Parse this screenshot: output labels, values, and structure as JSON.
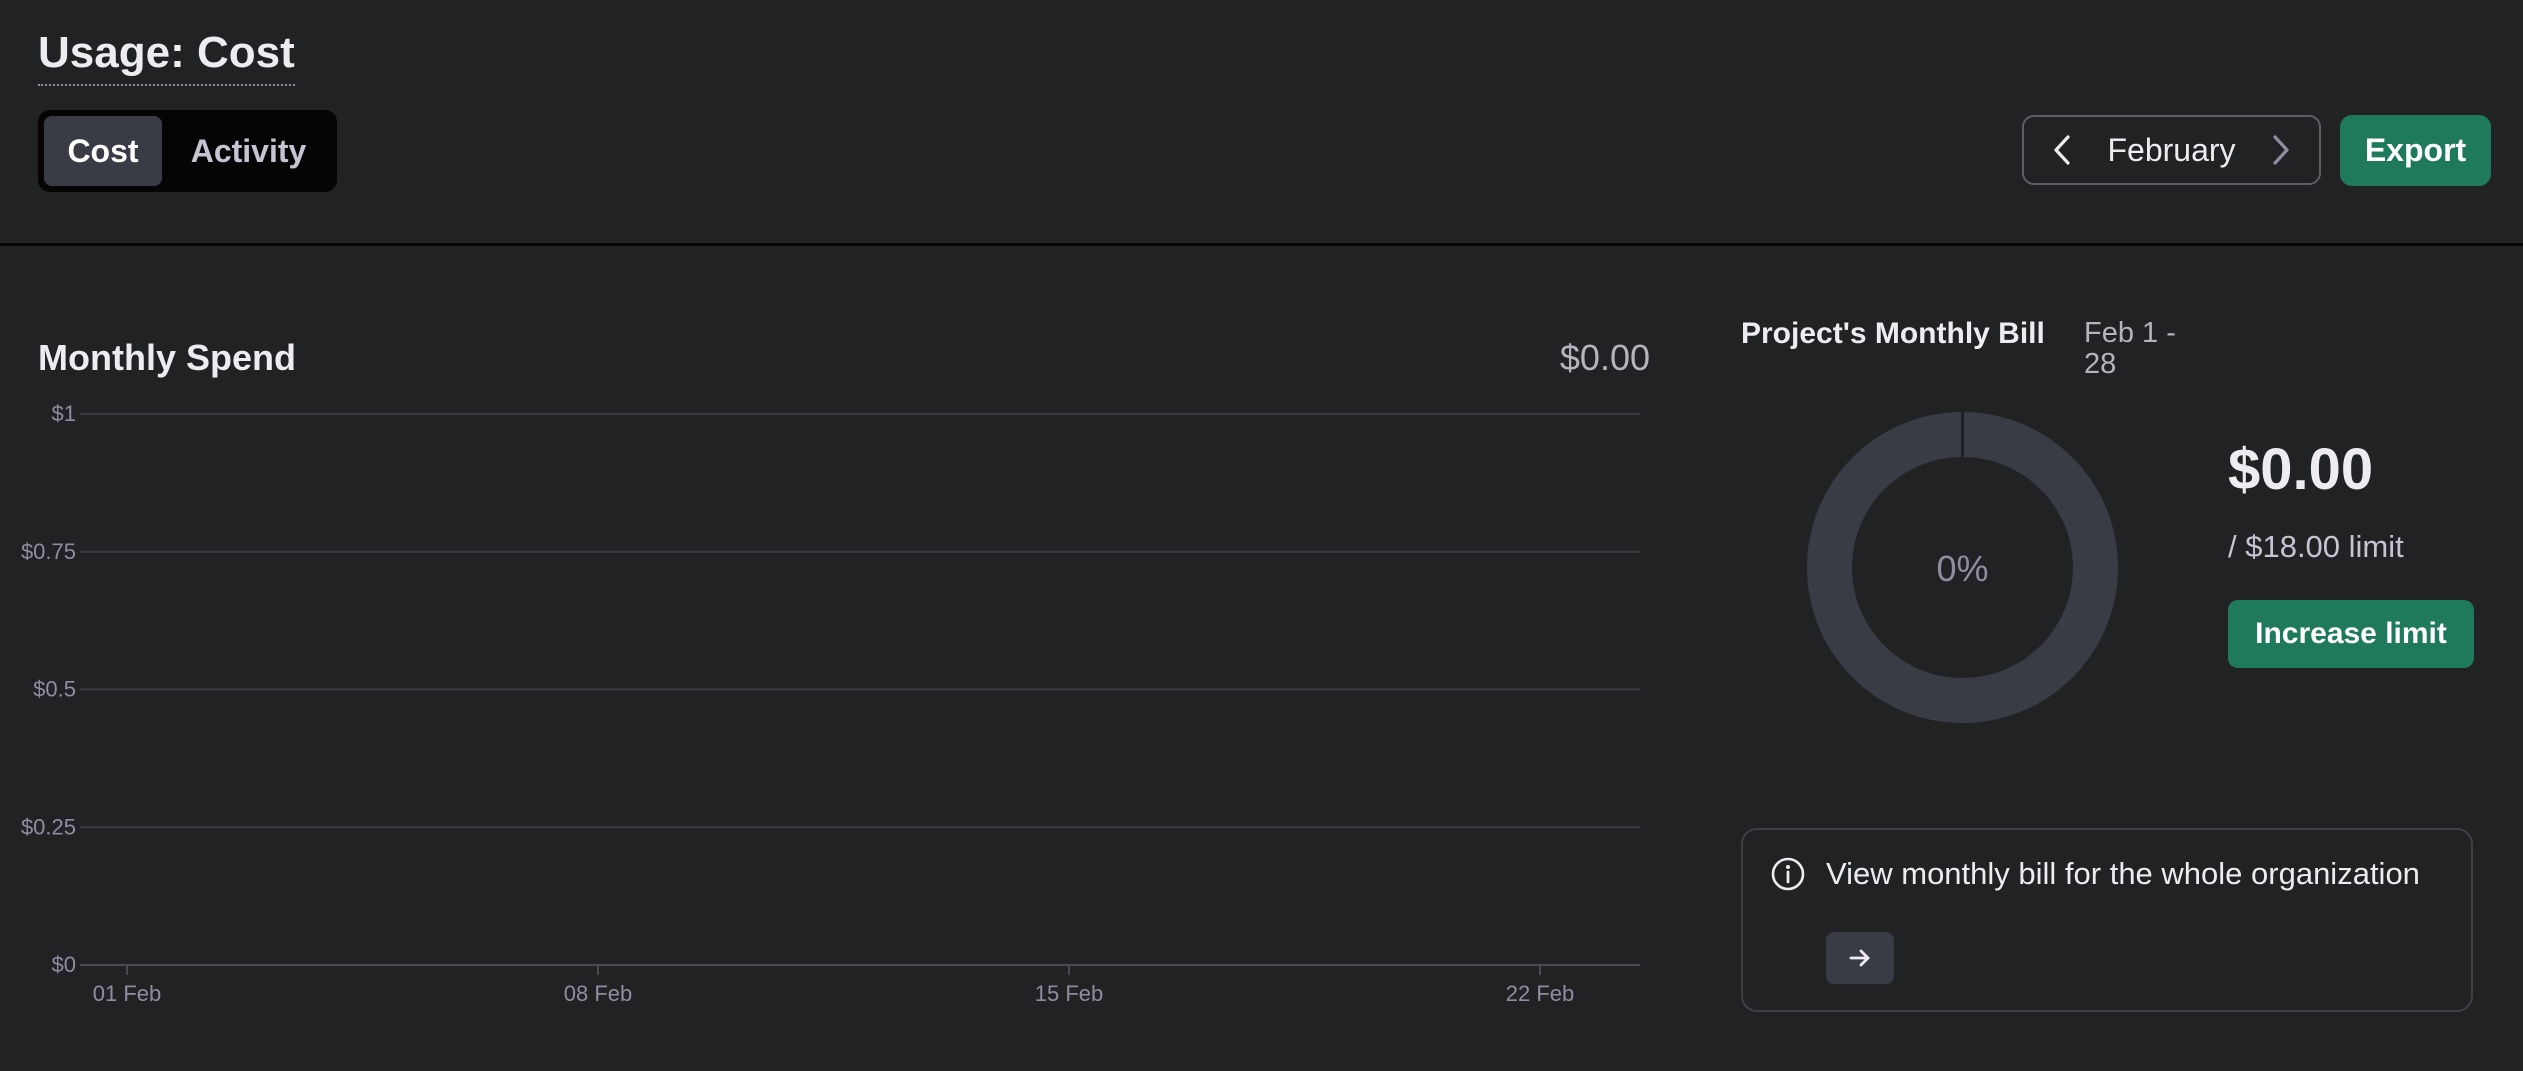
{
  "header": {
    "title": "Usage: Cost",
    "tabs": [
      {
        "label": "Cost",
        "active": true
      },
      {
        "label": "Activity",
        "active": false
      }
    ],
    "month_picker": {
      "month": "February",
      "prev_icon": "chevron-left-icon",
      "next_icon": "chevron-right-icon"
    },
    "export_label": "Export"
  },
  "monthly_spend": {
    "title": "Monthly Spend",
    "total": "$0.00"
  },
  "chart_data": {
    "type": "bar",
    "x_tick_labels": [
      "01 Feb",
      "08 Feb",
      "15 Feb",
      "22 Feb"
    ],
    "y_tick_labels": [
      "$0",
      "$0.25",
      "$0.5",
      "$0.75",
      "$1"
    ],
    "y_ticks": [
      0,
      0.25,
      0.5,
      0.75,
      1
    ],
    "ylim": [
      0,
      1
    ],
    "grid": true,
    "values": []
  },
  "bill": {
    "title": "Project's Monthly Bill",
    "range": "Feb 1 - 28",
    "percent_label": "0%",
    "percent_value": 0,
    "amount": "$0.00",
    "limit": "/ $18.00 limit",
    "increase_label": "Increase limit",
    "ring_color": "#3a3c45"
  },
  "org_card": {
    "icon": "info-icon",
    "text": "View monthly bill for the whole organization",
    "arrow_icon": "arrow-right-icon"
  },
  "colors": {
    "background": "#212224",
    "accent": "#1f7a5c"
  }
}
